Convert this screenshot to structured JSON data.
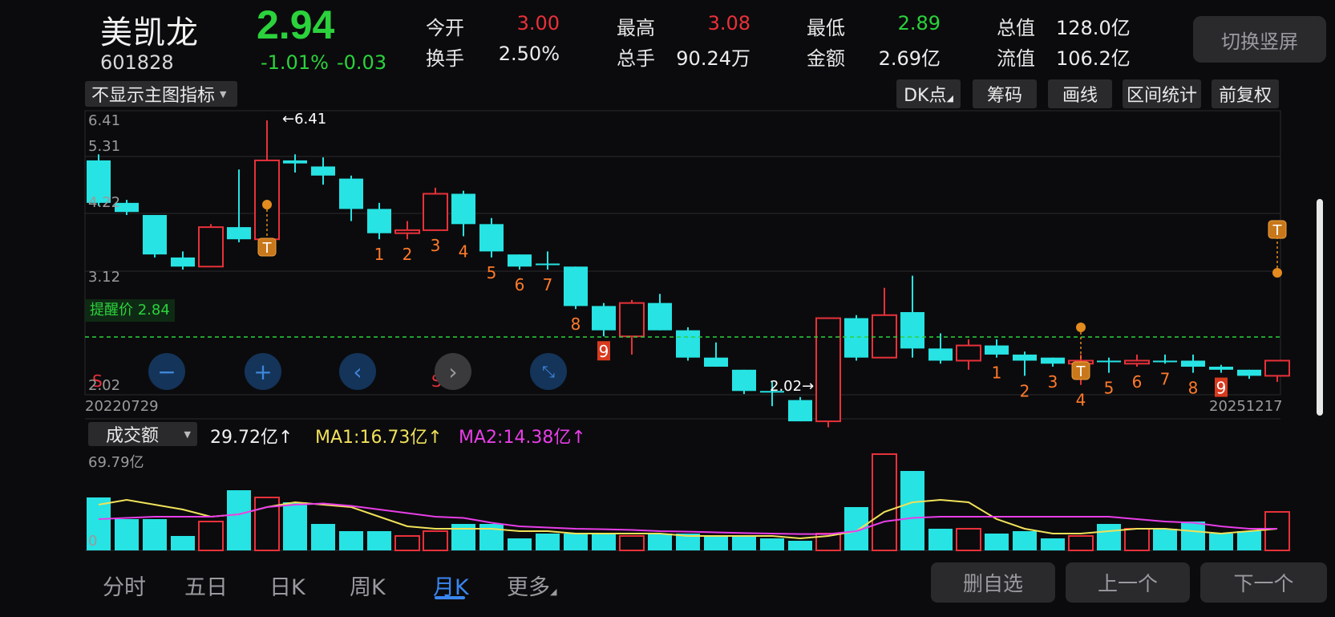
{
  "stock": {
    "name": "美凯龙",
    "code": "601828",
    "price": "2.94",
    "change_pct": "-1.01%",
    "change_abs": "-0.03"
  },
  "quote": {
    "open_label": "今开",
    "open": "3.00",
    "high_label": "最高",
    "high": "3.08",
    "low_label": "最低",
    "low": "2.89",
    "mcap_label": "总值",
    "mcap": "128.0亿",
    "turnover_label": "换手",
    "turnover": "2.50%",
    "volume_label": "总手",
    "volume": "90.24万",
    "amount_label": "金额",
    "amount": "2.69亿",
    "float_label": "流值",
    "float_cap": "106.2亿"
  },
  "switch_label": "切换竖屏",
  "toolbar": {
    "indicator": "不显示主图指标",
    "dk": "DK点",
    "chips": "筹码",
    "draw": "画线",
    "range": "区间统计",
    "adjust": "前复权"
  },
  "price_axis": [
    "6.41",
    "5.31",
    "4.22",
    "3.12",
    "2.02"
  ],
  "alert": {
    "label": "提醒价 2.84",
    "value": 2.84
  },
  "dates": {
    "start": "20220729",
    "end": "20251217"
  },
  "markers": {
    "max": "←6.41",
    "min": "2.02→",
    "t": "T",
    "s": "S"
  },
  "volume_panel": {
    "indicator": "成交额",
    "value": "29.72亿↑",
    "ma1": "MA1:16.73亿↑",
    "ma2": "MA2:14.38亿↑",
    "axis_top": "69.79亿",
    "axis_bottom": "0"
  },
  "bottom_tabs": [
    "分时",
    "五日",
    "日K",
    "周K",
    "月K",
    "更多"
  ],
  "bottom_buttons": {
    "remove": "删自选",
    "prev": "上一个",
    "next": "下一个"
  },
  "colors": {
    "up": "#e8313a",
    "down": "#27e3e3",
    "accent": "#2b7de9",
    "ma1": "#f0e15a",
    "ma2": "#e83ee8",
    "alert": "#2bd23c"
  },
  "chart_data": {
    "type": "candlestick",
    "period": "monthly",
    "ylim": [
      2.02,
      6.41
    ],
    "candles": [
      {
        "o": 5.75,
        "h": 5.85,
        "c": 5.05,
        "l": 5.0
      },
      {
        "o": 5.05,
        "h": 5.1,
        "c": 4.9,
        "l": 4.85
      },
      {
        "o": 4.85,
        "h": 4.85,
        "c": 4.2,
        "l": 4.15
      },
      {
        "o": 4.15,
        "h": 4.25,
        "c": 4.0,
        "l": 3.95
      },
      {
        "o": 4.0,
        "h": 4.7,
        "c": 4.65,
        "l": 4.0
      },
      {
        "o": 4.65,
        "h": 5.6,
        "c": 4.45,
        "l": 4.4
      },
      {
        "o": 4.45,
        "h": 6.41,
        "c": 5.75,
        "l": 4.4
      },
      {
        "o": 5.75,
        "h": 5.85,
        "c": 5.7,
        "l": 5.55
      },
      {
        "o": 5.65,
        "h": 5.8,
        "c": 5.5,
        "l": 5.35
      },
      {
        "o": 5.45,
        "h": 5.5,
        "c": 4.95,
        "l": 4.75
      },
      {
        "o": 4.95,
        "h": 5.05,
        "c": 4.55,
        "l": 4.45
      },
      {
        "o": 4.55,
        "h": 4.75,
        "c": 4.6,
        "l": 4.45
      },
      {
        "o": 4.6,
        "h": 5.3,
        "c": 5.2,
        "l": 4.6
      },
      {
        "o": 5.2,
        "h": 5.25,
        "c": 4.7,
        "l": 4.5
      },
      {
        "o": 4.7,
        "h": 4.8,
        "c": 4.25,
        "l": 4.15
      },
      {
        "o": 4.2,
        "h": 4.2,
        "c": 4.0,
        "l": 3.95
      },
      {
        "o": 4.05,
        "h": 4.25,
        "c": 4.05,
        "l": 3.95
      },
      {
        "o": 4.0,
        "h": 4.0,
        "c": 3.35,
        "l": 3.3
      },
      {
        "o": 3.35,
        "h": 3.4,
        "c": 2.95,
        "l": 2.85
      },
      {
        "o": 2.85,
        "h": 3.45,
        "c": 3.4,
        "l": 2.55
      },
      {
        "o": 3.4,
        "h": 3.55,
        "c": 2.95,
        "l": 2.95
      },
      {
        "o": 2.95,
        "h": 3.0,
        "c": 2.5,
        "l": 2.45
      },
      {
        "o": 2.5,
        "h": 2.75,
        "c": 2.35,
        "l": 2.35
      },
      {
        "o": 2.3,
        "h": 2.3,
        "c": 1.95,
        "l": 1.9
      },
      {
        "o": 1.95,
        "h": 2.1,
        "c": 1.95,
        "l": 1.7
      },
      {
        "o": 1.8,
        "h": 1.85,
        "c": 1.45,
        "l": 1.45
      },
      {
        "o": 1.45,
        "h": 3.15,
        "c": 3.15,
        "l": 1.35
      },
      {
        "o": 3.15,
        "h": 3.2,
        "c": 2.5,
        "l": 2.45
      },
      {
        "o": 2.5,
        "h": 3.65,
        "c": 3.2,
        "l": 2.5
      },
      {
        "o": 3.25,
        "h": 3.85,
        "c": 2.65,
        "l": 2.5
      },
      {
        "o": 2.65,
        "h": 2.9,
        "c": 2.45,
        "l": 2.4
      },
      {
        "o": 2.45,
        "h": 2.8,
        "c": 2.7,
        "l": 2.3
      },
      {
        "o": 2.7,
        "h": 2.8,
        "c": 2.55,
        "l": 2.5
      },
      {
        "o": 2.55,
        "h": 2.6,
        "c": 2.45,
        "l": 2.2
      },
      {
        "o": 2.5,
        "h": 2.5,
        "c": 2.4,
        "l": 2.35
      },
      {
        "o": 2.4,
        "h": 2.55,
        "c": 2.45,
        "l": 2.05
      },
      {
        "o": 2.45,
        "h": 2.5,
        "c": 2.45,
        "l": 2.25
      },
      {
        "o": 2.4,
        "h": 2.55,
        "c": 2.45,
        "l": 2.35
      },
      {
        "o": 2.45,
        "h": 2.55,
        "c": 2.45,
        "l": 2.4
      },
      {
        "o": 2.45,
        "h": 2.55,
        "c": 2.35,
        "l": 2.25
      },
      {
        "o": 2.35,
        "h": 2.38,
        "c": 2.3,
        "l": 2.25
      },
      {
        "o": 2.3,
        "h": 2.3,
        "c": 2.2,
        "l": 2.15
      },
      {
        "o": 2.2,
        "h": 2.45,
        "c": 2.45,
        "l": 2.1
      }
    ],
    "amounts": [
      22,
      13,
      13,
      6,
      12,
      25,
      22,
      20,
      11,
      8,
      8,
      6,
      8,
      11,
      11,
      5,
      7,
      7,
      7,
      6,
      7,
      7,
      6,
      6,
      5,
      4,
      7,
      18,
      40,
      33,
      9,
      9,
      7,
      8,
      5,
      6,
      11,
      9,
      9,
      12,
      7,
      8,
      16
    ],
    "ma1": [
      19,
      21,
      19,
      17,
      14,
      15,
      18,
      20,
      19,
      18,
      14,
      10,
      9,
      9,
      9,
      8,
      8,
      7,
      7,
      7,
      7,
      6,
      6,
      6,
      6,
      5,
      6,
      8,
      16,
      20,
      21,
      20,
      13,
      9,
      7,
      7,
      8,
      9,
      9,
      8,
      7,
      8,
      9
    ],
    "ma2": [
      13,
      13.5,
      14,
      14,
      14,
      15,
      18,
      19,
      19.5,
      18.5,
      17,
      15.5,
      14,
      13.5,
      11.5,
      10,
      9.5,
      9,
      8.8,
      8.5,
      8,
      7.8,
      7.5,
      7.2,
      7,
      6.8,
      6.8,
      8,
      12,
      13.5,
      14,
      14,
      14,
      14,
      14,
      14,
      14,
      13,
      12,
      11.5,
      10,
      9,
      9
    ]
  }
}
